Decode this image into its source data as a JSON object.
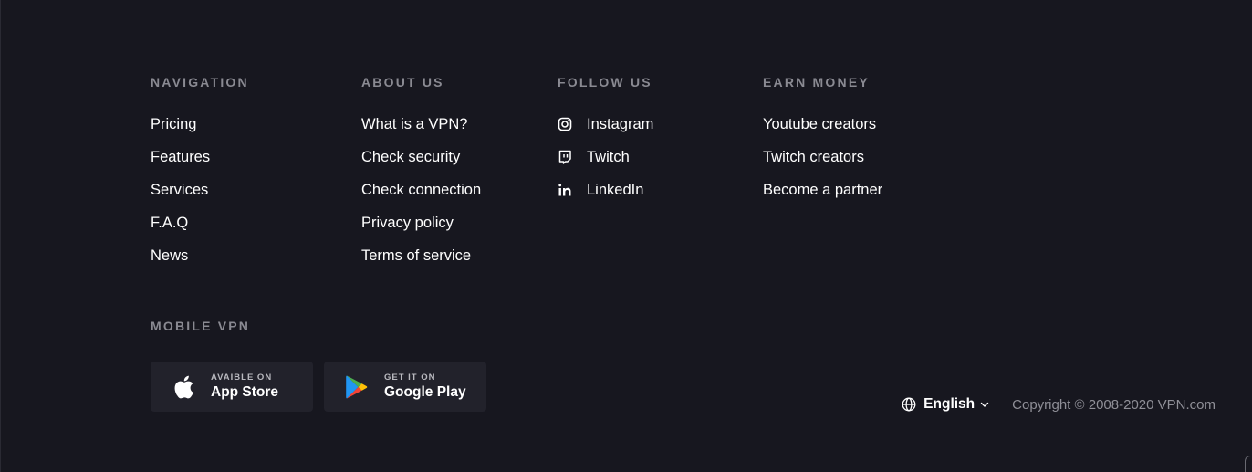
{
  "navigation": {
    "title": "NAVIGATION",
    "items": [
      "Pricing",
      "Features",
      "Services",
      "F.A.Q",
      "News"
    ]
  },
  "about": {
    "title": "ABOUT US",
    "items": [
      "What is a VPN?",
      "Check security",
      "Check connection",
      "Privacy policy",
      "Terms of service"
    ]
  },
  "follow": {
    "title": "FOLLOW US",
    "items": [
      {
        "label": "Instagram",
        "icon": "instagram-icon"
      },
      {
        "label": "Twitch",
        "icon": "twitch-icon"
      },
      {
        "label": "LinkedIn",
        "icon": "linkedin-icon"
      }
    ]
  },
  "earn": {
    "title": "EARN MONEY",
    "items": [
      "Youtube creators",
      "Twitch creators",
      "Become a partner"
    ]
  },
  "mobile": {
    "title": "MOBILE VPN",
    "app_store": {
      "small": "AVAIBLE ON",
      "big": "App Store",
      "icon": "apple-icon"
    },
    "google_play": {
      "small": "GET IT ON",
      "big": "Google Play",
      "icon": "google-play-icon"
    }
  },
  "footer": {
    "language": "English",
    "copyright": "Copyright © 2008-2020 VPN.com"
  },
  "colors": {
    "background": "#17171f",
    "button_bg": "#22222b",
    "heading": "#8a8a92",
    "text": "#ffffff",
    "muted": "#8f8f97"
  }
}
